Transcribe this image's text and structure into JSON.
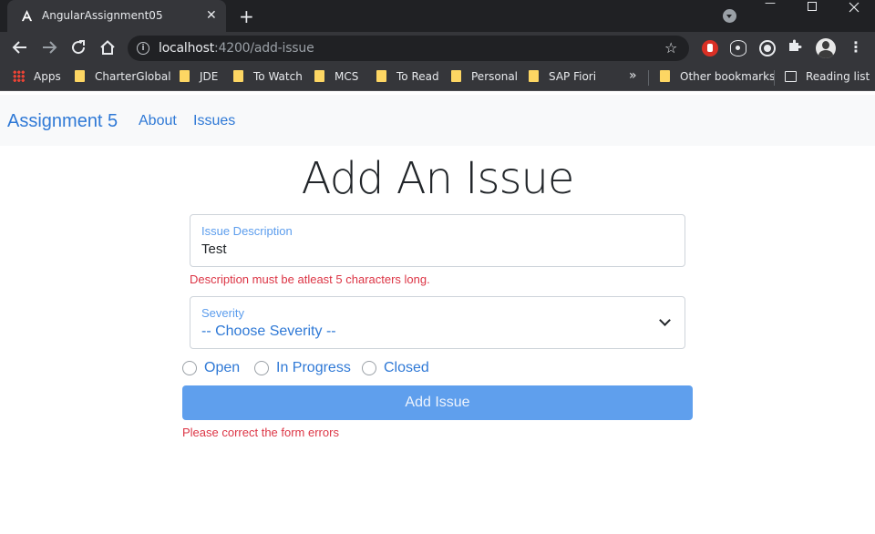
{
  "browser": {
    "tab": {
      "title": "AngularAssignment05",
      "close": "✕"
    },
    "new_tab": "+",
    "window": {
      "minimize": "—"
    },
    "url_host": "localhost",
    "url_rest": ":4200/add-issue",
    "bookmarks": [
      {
        "label": "Apps",
        "icon": "apps-grid-icon"
      },
      {
        "label": "CharterGlobal",
        "icon": "folder-icon"
      },
      {
        "label": "JDE",
        "icon": "folder-icon"
      },
      {
        "label": "To Watch",
        "icon": "folder-icon"
      },
      {
        "label": "MCS",
        "icon": "folder-icon"
      },
      {
        "label": "To Read",
        "icon": "folder-icon"
      },
      {
        "label": "Personal",
        "icon": "folder-icon"
      },
      {
        "label": "SAP Fiori",
        "icon": "folder-icon"
      }
    ],
    "overflow": "»",
    "other_bookmarks": "Other bookmarks",
    "reading_list": "Reading list"
  },
  "app": {
    "brand": "Assignment 5",
    "nav": {
      "about": "About",
      "issues": "Issues"
    }
  },
  "form": {
    "title": "Add An Issue",
    "description": {
      "label": "Issue Description",
      "value": "Test",
      "error": "Description must be atleast 5 characters long."
    },
    "severity": {
      "label": "Severity",
      "value": "-- Choose Severity --"
    },
    "status_options": [
      "Open",
      "In Progress",
      "Closed"
    ],
    "submit_label": "Add Issue",
    "form_error": "Please correct the form errors"
  },
  "colors": {
    "primary": "#2f79d6",
    "primary_disabled": "#5f9fed",
    "error": "#dc3545",
    "navbar_bg": "#f8f9fa"
  }
}
